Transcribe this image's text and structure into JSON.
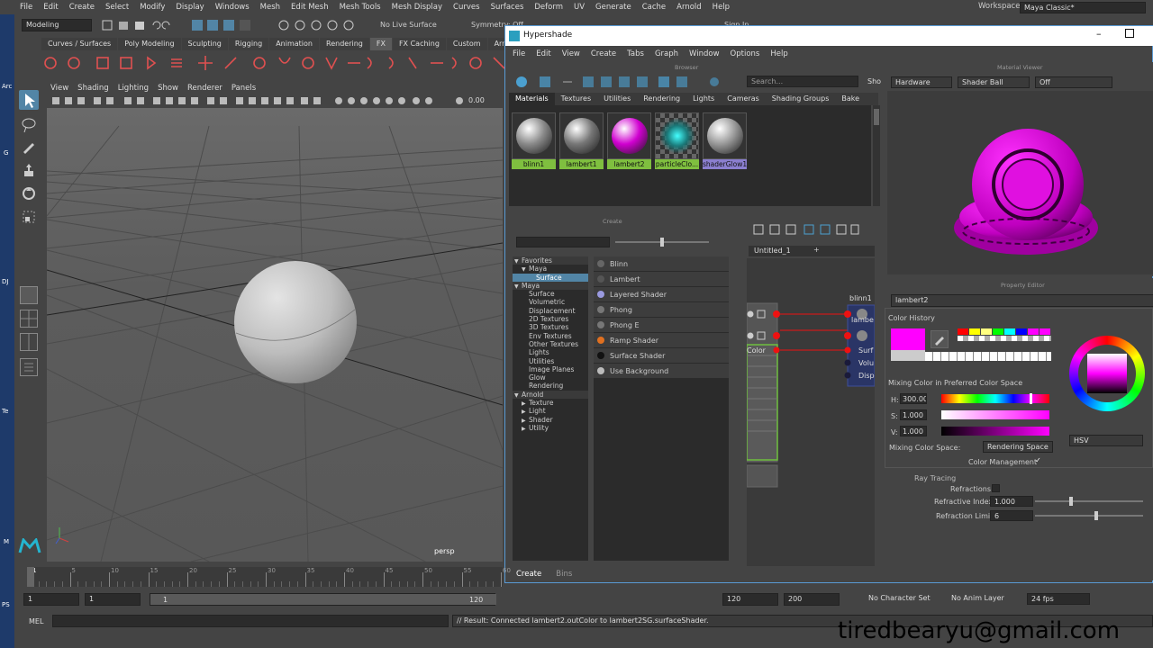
{
  "menubar": {
    "items": [
      "File",
      "Edit",
      "Create",
      "Select",
      "Modify",
      "Display",
      "Windows",
      "Mesh",
      "Edit Mesh",
      "Mesh Tools",
      "Mesh Display",
      "Curves",
      "Surfaces",
      "Deform",
      "UV",
      "Generate",
      "Cache",
      "Arnold",
      "Help"
    ],
    "workspace_label": "Workspace :",
    "workspace_value": "Maya Classic*"
  },
  "statusline": {
    "mode": "Modeling",
    "live_surface": "No Live Surface",
    "symmetry": "Symmetry: Off",
    "sign_in": "Sign In"
  },
  "shelf": {
    "tabs": [
      "Curves / Surfaces",
      "Poly Modeling",
      "Sculpting",
      "Rigging",
      "Animation",
      "Rendering",
      "FX",
      "FX Caching",
      "Custom",
      "Arnold"
    ],
    "active": "FX"
  },
  "viewport": {
    "menus": [
      "View",
      "Shading",
      "Lighting",
      "Show",
      "Renderer",
      "Panels"
    ],
    "value": "0.00",
    "camera": "persp"
  },
  "left_desktop_labels": [
    "Arc",
    "G",
    "Te",
    "DJ",
    "M",
    "PS"
  ],
  "timeline": {
    "ticks": [
      "1",
      "5",
      "10",
      "15",
      "20",
      "25",
      "30",
      "35",
      "40",
      "45",
      "50",
      "55",
      "60"
    ],
    "current": "1"
  },
  "range": {
    "start": "1",
    "start2": "1",
    "range_start": "1",
    "range_end": "120",
    "end": "120",
    "end2": "200",
    "character_set": "No Character Set",
    "anim_layer": "No Anim Layer",
    "fps": "24 fps"
  },
  "cmdline": {
    "label": "MEL",
    "result": "// Result: Connected lambert2.outColor to lambert2SG.surfaceShader."
  },
  "watermark": "tiredbearyu@gmail.com",
  "hypershade": {
    "title": "Hypershade",
    "menus": [
      "File",
      "Edit",
      "View",
      "Create",
      "Tabs",
      "Graph",
      "Window",
      "Options",
      "Help"
    ],
    "browser_title": "Browser",
    "search_placeholder": "Search...",
    "show_label": "Sho",
    "browser_tabs": [
      "Materials",
      "Textures",
      "Utilities",
      "Rendering",
      "Lights",
      "Cameras",
      "Shading Groups",
      "Bake"
    ],
    "materials": [
      {
        "name": "blinn1",
        "color": "#8a8a8a",
        "label_bg": "#7fbf3f"
      },
      {
        "name": "lambert1",
        "color": "#777777",
        "label_bg": "#7fbf3f"
      },
      {
        "name": "lambert2",
        "color": "#d000d0",
        "label_bg": "#7fbf3f"
      },
      {
        "name": "particleClo...",
        "color": "#2aa5a5",
        "label_bg": "#7fbf3f"
      },
      {
        "name": "shaderGlow1",
        "color": "#999999",
        "label_bg": "#8b7fd0"
      }
    ],
    "create_title": "Create",
    "create_tree": [
      {
        "label": "Favorites",
        "level": 0,
        "arrow": "▼"
      },
      {
        "label": "Maya",
        "level": 1,
        "arrow": "▼"
      },
      {
        "label": "Surface",
        "level": 2,
        "arrow": "",
        "selected": true
      },
      {
        "label": "Maya",
        "level": 0,
        "arrow": "▼"
      },
      {
        "label": "Surface",
        "level": 1,
        "arrow": ""
      },
      {
        "label": "Volumetric",
        "level": 1,
        "arrow": ""
      },
      {
        "label": "Displacement",
        "level": 1,
        "arrow": ""
      },
      {
        "label": "2D Textures",
        "level": 1,
        "arrow": ""
      },
      {
        "label": "3D Textures",
        "level": 1,
        "arrow": ""
      },
      {
        "label": "Env Textures",
        "level": 1,
        "arrow": ""
      },
      {
        "label": "Other Textures",
        "level": 1,
        "arrow": ""
      },
      {
        "label": "Lights",
        "level": 1,
        "arrow": ""
      },
      {
        "label": "Utilities",
        "level": 1,
        "arrow": ""
      },
      {
        "label": "Image Planes",
        "level": 1,
        "arrow": ""
      },
      {
        "label": "Glow",
        "level": 1,
        "arrow": ""
      },
      {
        "label": "Rendering",
        "level": 1,
        "arrow": ""
      },
      {
        "label": "Arnold",
        "level": 0,
        "arrow": "▼"
      },
      {
        "label": "Texture",
        "level": 1,
        "arrow": "▶"
      },
      {
        "label": "Light",
        "level": 1,
        "arrow": "▶"
      },
      {
        "label": "Shader",
        "level": 1,
        "arrow": "▶"
      },
      {
        "label": "Utility",
        "level": 1,
        "arrow": "▶"
      }
    ],
    "create_items": [
      {
        "label": "Blinn",
        "dot": "#666"
      },
      {
        "label": "Lambert",
        "dot": "#555"
      },
      {
        "label": "Layered Shader",
        "dot": "#9a9ae0"
      },
      {
        "label": "Phong",
        "dot": "#777"
      },
      {
        "label": "Phong E",
        "dot": "#777"
      },
      {
        "label": "Ramp Shader",
        "dot": "#e07020"
      },
      {
        "label": "Surface Shader",
        "dot": "#111"
      },
      {
        "label": "Use Background",
        "dot": "#bbb"
      }
    ],
    "bottom_tabs": [
      "Create",
      "Bins"
    ],
    "graph_tab": "Untitled_1",
    "graph_add": "+",
    "node_blinn": "blinn1",
    "node_lambert_short": "lambe",
    "node_ports": [
      "Surf",
      "Volu",
      "Disp"
    ],
    "node_color_label": "Color",
    "material_viewer_title": "Material Viewer",
    "mv_renderer": "Hardware",
    "mv_geometry": "Shader Ball",
    "mv_lighting": "Off",
    "property_editor_title": "Property Editor",
    "node_name": "lambert2",
    "ray_tracing": "Ray Tracing",
    "refractions_label": "Refractions",
    "refractive_index_label": "Refractive Index",
    "refractive_index": "1.000",
    "refraction_limit_label": "Refraction Limit",
    "refraction_limit": "6"
  },
  "color_chooser": {
    "history_label": "Color History",
    "current_color": "#ff00ff",
    "history_colors": [
      "#ff0000",
      "#ffff00",
      "#ffff80",
      "#00ff00",
      "#00ffff",
      "#0000ff",
      "#ff00ff",
      "#ff00ff"
    ],
    "mixing_label": "Mixing Color in Preferred Color Space",
    "h_label": "H:",
    "h_value": "300.00",
    "s_label": "S:",
    "s_value": "1.000",
    "v_label": "V:",
    "v_value": "1.000",
    "space_label": "Mixing Color Space:",
    "space_value": "Rendering Space",
    "management_label": "Color Management",
    "mode": "HSV"
  }
}
